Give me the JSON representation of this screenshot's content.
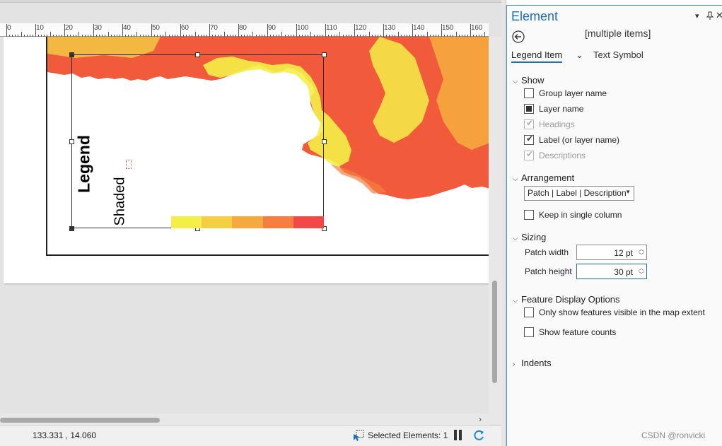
{
  "ruler": {
    "labels": [
      "0",
      "10",
      "20",
      "30",
      "40",
      "50",
      "60",
      "70",
      "80",
      "90",
      "100",
      "110",
      "120",
      "130",
      "140",
      "150",
      "160"
    ]
  },
  "legend": {
    "title": "Legend",
    "layer_label": "Shaded",
    "patch_colors": [
      "#f4ef48",
      "#f4cf44",
      "#f5a93f",
      "#f47f40",
      "#f14848"
    ]
  },
  "status": {
    "coords": "133.331 , 14.060",
    "selected": "Selected Elements: 1"
  },
  "pane": {
    "title": "Element",
    "selected_name": "[multiple items]",
    "tabs": {
      "legend_item": "Legend Item",
      "text_symbol": "Text Symbol"
    },
    "show": {
      "header": "Show",
      "items": [
        {
          "label": "Group layer name",
          "state": "unchecked"
        },
        {
          "label": "Layer name",
          "state": "partial"
        },
        {
          "label": "Headings",
          "state": "checked-disabled"
        },
        {
          "label": "Label (or layer name)",
          "state": "checked"
        },
        {
          "label": "Descriptions",
          "state": "checked-disabled"
        }
      ]
    },
    "arrangement": {
      "header": "Arrangement",
      "value": "Patch | Label | Description",
      "single_column_label": "Keep in single column"
    },
    "sizing": {
      "header": "Sizing",
      "patch_width_label": "Patch width",
      "patch_width_value": "12 pt",
      "patch_height_label": "Patch height",
      "patch_height_value": "30 pt"
    },
    "feature_display": {
      "header": "Feature Display Options",
      "visible_extent_label": "Only show features visible in the map extent",
      "counts_label": "Show feature counts"
    },
    "indents": {
      "header": "Indents"
    }
  },
  "watermark": "CSDN @ronvicki",
  "colors": {
    "accent": "#1a6fb8",
    "map_red": "#f15a3a",
    "map_yellow": "#f4ef48",
    "map_orange": "#f5a93f"
  },
  "icons": [
    "back-arrow-icon",
    "pin-icon",
    "close-icon",
    "dropdown-icon",
    "selection-icon",
    "pause-icon",
    "refresh-icon"
  ]
}
